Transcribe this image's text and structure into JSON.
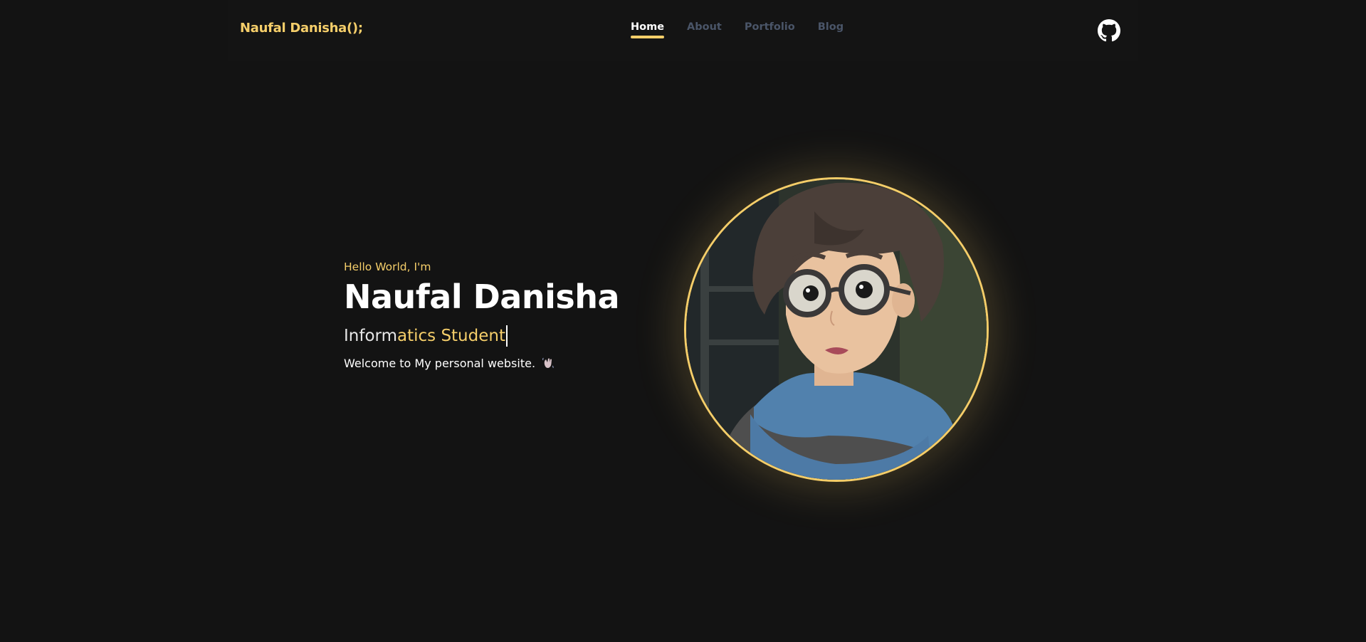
{
  "header": {
    "logo": "Naufal Danisha();",
    "nav": [
      {
        "label": "Home",
        "active": true
      },
      {
        "label": "About",
        "active": false
      },
      {
        "label": "Portfolio",
        "active": false
      },
      {
        "label": "Blog",
        "active": false
      }
    ],
    "github_icon": "github-icon"
  },
  "hero": {
    "greeting": "Hello World, I'm",
    "name": "Naufal Danisha",
    "role_part1": "Inform",
    "role_part2": "atics Student",
    "welcome": "Welcome to My personal website.",
    "wave_icon": "waving-hand-icon"
  },
  "colors": {
    "accent": "#f5ce6a",
    "background": "#131313",
    "nav_inactive": "#4a5568"
  }
}
